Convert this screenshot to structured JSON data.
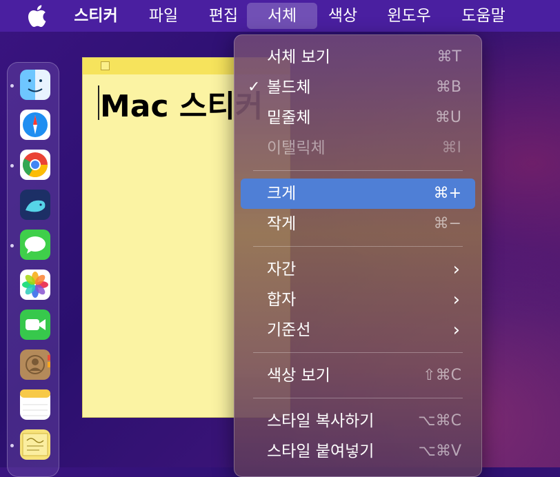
{
  "menubar": {
    "app": "스티커",
    "items": [
      "파일",
      "편집",
      "서체",
      "색상",
      "윈도우",
      "도움말"
    ]
  },
  "note": {
    "text": "Mac 스티커"
  },
  "menu": {
    "items": [
      {
        "label": "서체 보기",
        "shortcut": "⌘T"
      },
      {
        "label": "볼드체",
        "shortcut": "⌘B",
        "checked": "✓"
      },
      {
        "label": "밑줄체",
        "shortcut": "⌘U"
      },
      {
        "label": "이탤릭체",
        "shortcut": "⌘I"
      },
      {
        "label": "크게",
        "shortcut": "⌘+"
      },
      {
        "label": "작게",
        "shortcut": "⌘−"
      },
      {
        "label": "자간",
        "submenu": "›"
      },
      {
        "label": "합자",
        "submenu": "›"
      },
      {
        "label": "기준선",
        "submenu": "›"
      },
      {
        "label": "색상 보기",
        "shortcut": "⇧⌘C"
      },
      {
        "label": "스타일 복사하기",
        "shortcut": "⌥⌘C"
      },
      {
        "label": "스타일 붙여넣기",
        "shortcut": "⌥⌘V"
      }
    ]
  },
  "colors": {
    "highlight": "#4f7fd6",
    "menubar": "#4a1fa0",
    "note": "#fbf3a3"
  },
  "dock": {
    "icons": [
      "finder-icon",
      "safari-icon",
      "chrome-icon",
      "whale-browser-icon",
      "messages-icon",
      "photos-icon",
      "facetime-icon",
      "contacts-icon",
      "notes-icon",
      "stickies-icon"
    ]
  }
}
